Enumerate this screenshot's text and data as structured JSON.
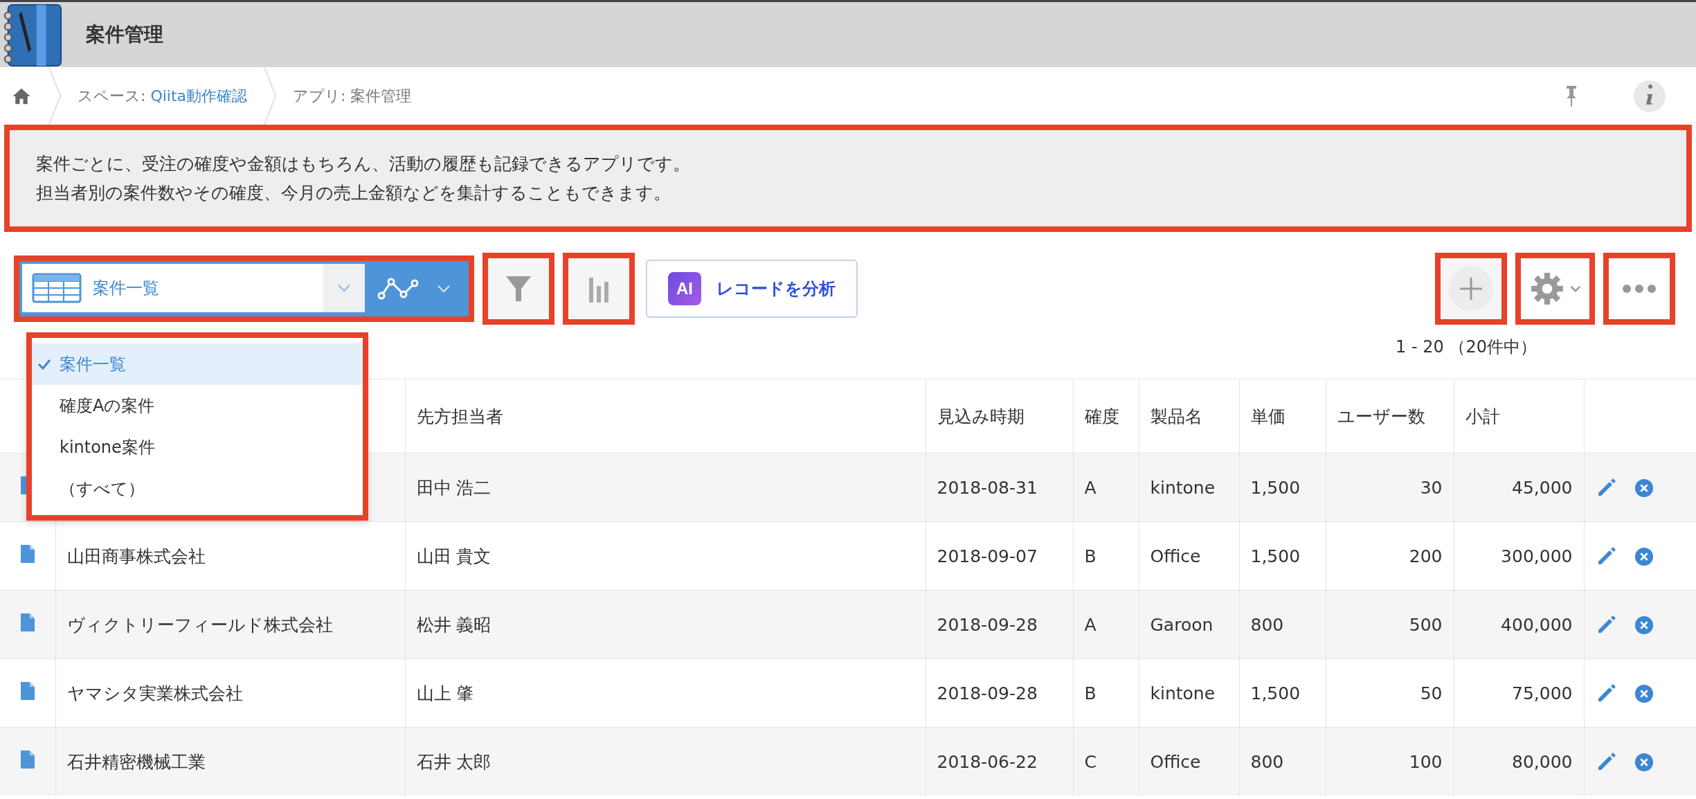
{
  "app": {
    "title": "案件管理"
  },
  "breadcrumb": {
    "space_label": "スペース: ",
    "space_name": "Qiita動作確認",
    "app_label": "アプリ: 案件管理"
  },
  "description": {
    "highlighted": true,
    "lines": [
      "案件ごとに、受注の確度や金額はもちろん、活動の履歴も記録できるアプリです。",
      "担当者別の案件数やその確度、今月の売上金額などを集計することもできます。"
    ]
  },
  "toolbar": {
    "view": {
      "label": "案件一覧",
      "highlighted": true
    },
    "filter": {
      "highlighted": true
    },
    "graph": {
      "highlighted": true
    },
    "analyze": {
      "badge": "AI",
      "label": "レコードを分析"
    },
    "add": {
      "highlighted": true
    },
    "settings": {
      "highlighted": true
    },
    "more": {
      "highlighted": true
    }
  },
  "view_menu": {
    "highlighted": true,
    "items": [
      {
        "label": "案件一覧",
        "selected": true
      },
      {
        "label": "確度Aの案件",
        "selected": false
      },
      {
        "label": "kintone案件",
        "selected": false
      },
      {
        "label": "（すべて）",
        "selected": false
      }
    ]
  },
  "count": "1 - 20 （20件中）",
  "table": {
    "columns": [
      "先方担当者",
      "見込み時期",
      "確度",
      "製品名",
      "単価",
      "ユーザー数",
      "小計"
    ],
    "rows": [
      {
        "contact": "田中 浩二",
        "date": "2018-08-31",
        "confidence": "A",
        "product": "kintone",
        "unit_price": "1,500",
        "users": "30",
        "subtotal": "45,000"
      },
      {
        "company": "山田商事株式会社",
        "contact": "山田 貴文",
        "date": "2018-09-07",
        "confidence": "B",
        "product": "Office",
        "unit_price": "1,500",
        "users": "200",
        "subtotal": "300,000"
      },
      {
        "company": "ヴィクトリーフィールド株式会社",
        "contact": "松井 義昭",
        "date": "2018-09-28",
        "confidence": "A",
        "product": "Garoon",
        "unit_price": "800",
        "users": "500",
        "subtotal": "400,000"
      },
      {
        "company": "ヤマシタ実業株式会社",
        "contact": "山上 肇",
        "date": "2018-09-28",
        "confidence": "B",
        "product": "kintone",
        "unit_price": "1,500",
        "users": "50",
        "subtotal": "75,000"
      },
      {
        "company": "石井精密機械工業",
        "contact": "石井 太郎",
        "date": "2018-06-22",
        "confidence": "C",
        "product": "Office",
        "unit_price": "800",
        "users": "100",
        "subtotal": "80,000"
      }
    ]
  }
}
